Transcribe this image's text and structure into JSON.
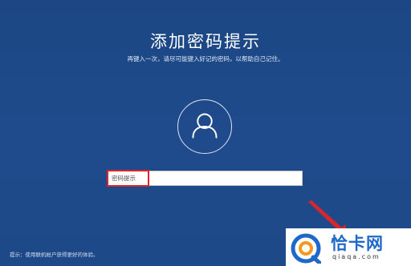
{
  "screen": {
    "title": "添加密码提示",
    "subtitle": "再键入一次，请尽可能键入好记的密码，以帮助自己记住。"
  },
  "avatar": {
    "icon": "user-icon"
  },
  "hint_field": {
    "placeholder": "密码提示",
    "value": ""
  },
  "footer": {
    "note": "提示：使用联机帐户获得更好的体验。"
  },
  "watermark": {
    "name": "恰卡网",
    "domain": "qiaqa.com",
    "logo_icon": "qiaqa-logo"
  },
  "colors": {
    "background": "#1e4a8a",
    "highlight": "#d9262a",
    "watermark_blue": "#1f67c8",
    "watermark_orange": "#f39a1e"
  }
}
